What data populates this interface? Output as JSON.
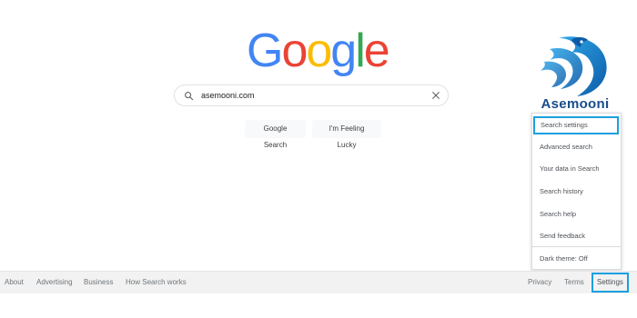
{
  "logo": {
    "letters": [
      "G",
      "o",
      "o",
      "g",
      "l",
      "e"
    ],
    "colors": [
      "#4285f4",
      "#ea4335",
      "#fbbc05",
      "#4285f4",
      "#34a853",
      "#ea4335"
    ]
  },
  "search": {
    "value": "asemooni.com",
    "icon": "search-icon",
    "clear_icon": "close-icon"
  },
  "buttons": {
    "google_search": "Google Search",
    "feeling_lucky": "I'm Feeling Lucky"
  },
  "brand": {
    "name": "Asemooni",
    "icon": "eagle-logo-icon",
    "color": "#1a4c8c"
  },
  "settings_menu": {
    "items": [
      "Search settings",
      "Advanced search",
      "Your data in Search",
      "Search history",
      "Search help",
      "Send feedback",
      "Dark theme: Off"
    ],
    "highlight_color": "#1a9fe0"
  },
  "footer": {
    "left": [
      "About",
      "Advertising",
      "Business",
      "How Search works"
    ],
    "right": [
      "Privacy",
      "Terms",
      "Settings"
    ]
  }
}
